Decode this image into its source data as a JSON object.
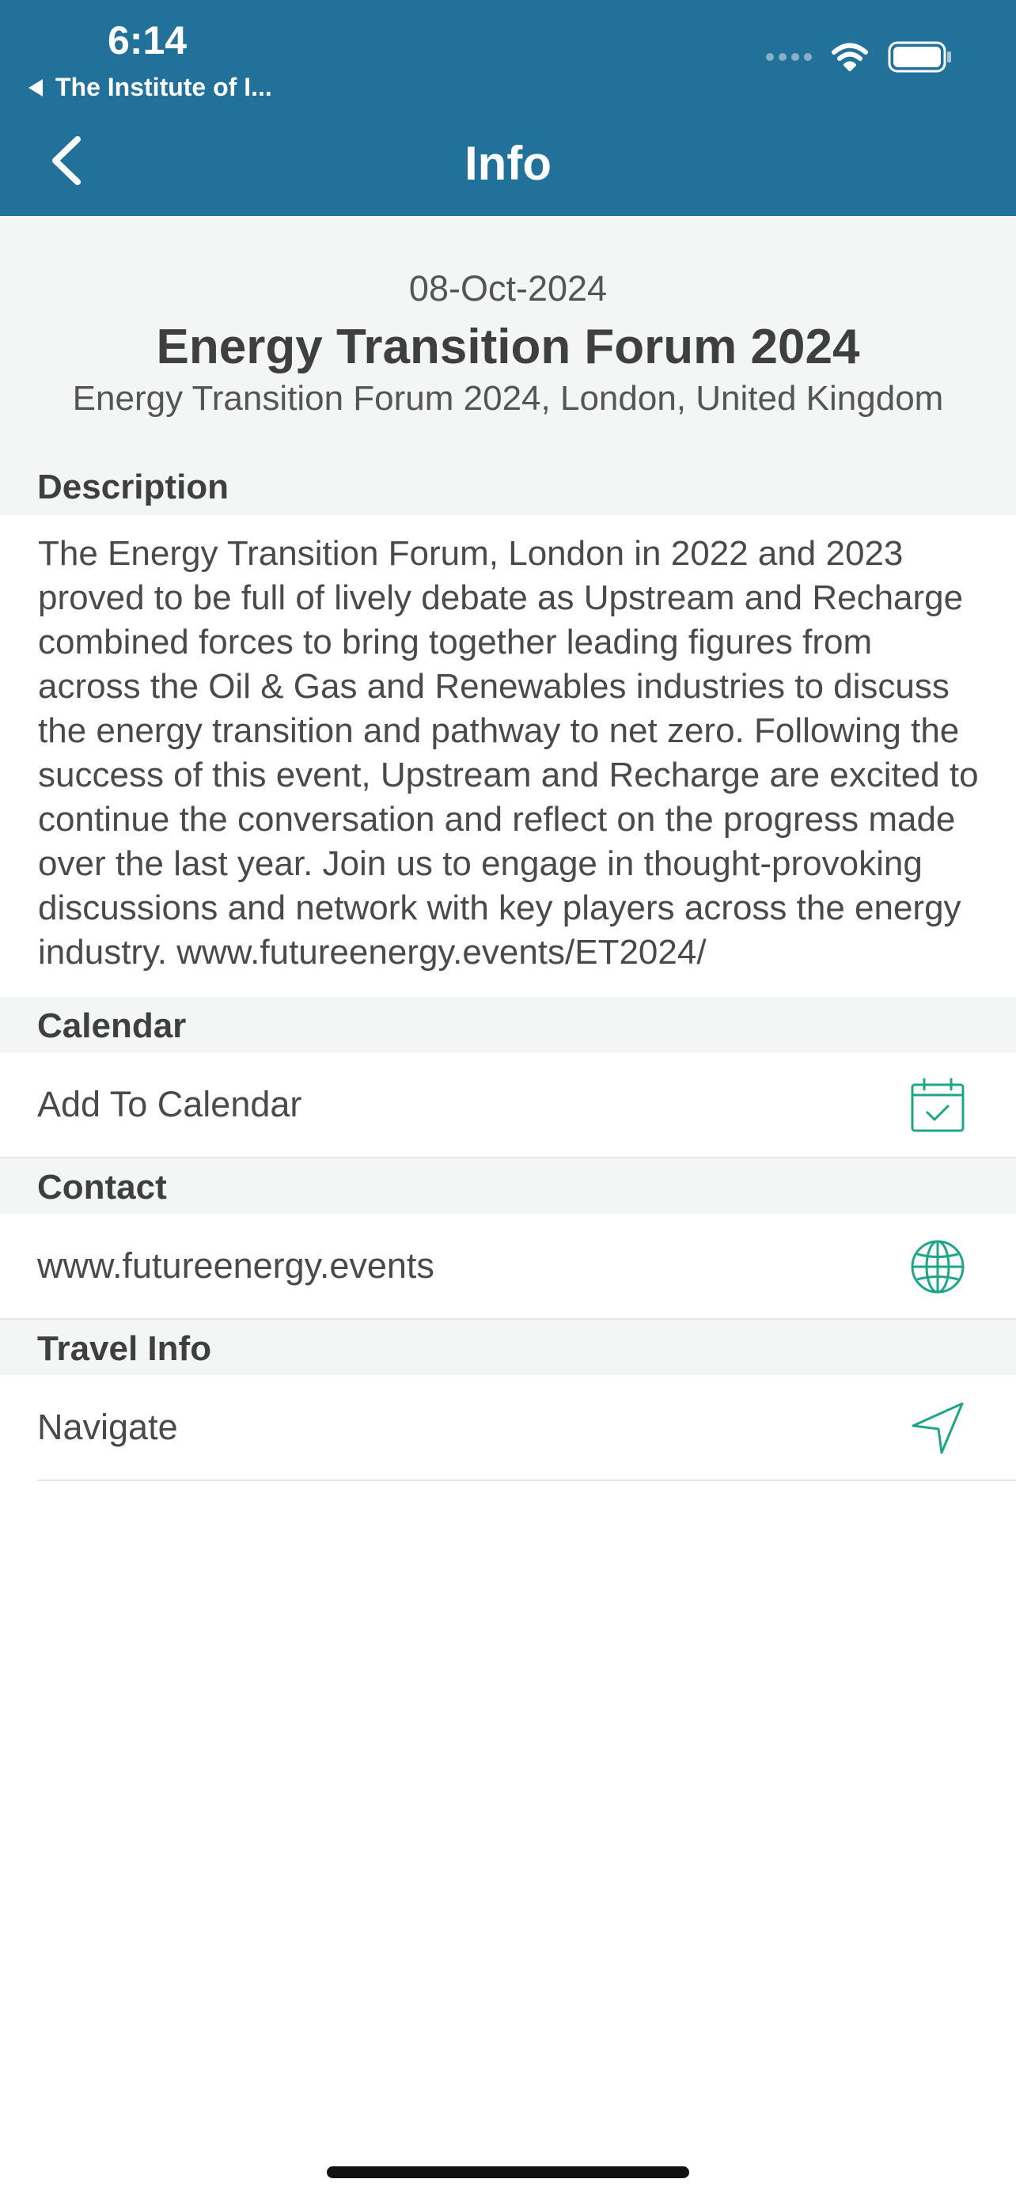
{
  "status_bar": {
    "time": "6:14",
    "back_app": "The Institute of I..."
  },
  "nav": {
    "title": "Info"
  },
  "event": {
    "date": "08-Oct-2024",
    "title": "Energy Transition Forum 2024",
    "location": "Energy Transition Forum 2024, London, United Kingdom"
  },
  "sections": {
    "description_label": "Description",
    "description_text": "The Energy Transition Forum, London in 2022 and 2023\nproved to be full of lively debate as Upstream and Recharge\ncombined forces to bring together leading figures from\nacross the Oil & Gas and Renewables industries to discuss\nthe energy transition and pathway to net zero. Following the\nsuccess of this event, Upstream and Recharge are excited to\ncontinue the conversation and reflect on the progress made\nover the last year. Join us to engage in thought-provoking\ndiscussions and network with key players across the energy\nindustry. www.futureenergy.events/ET2024/",
    "calendar_label": "Calendar",
    "calendar_action": "Add To Calendar",
    "contact_label": "Contact",
    "contact_website": "www.futureenergy.events",
    "travel_label": "Travel Info",
    "travel_action": "Navigate"
  },
  "colors": {
    "header": "#22719a",
    "section_band": "#f4f5f5",
    "icon_accent": "#1fa58a"
  },
  "icons": {
    "calendar": "calendar-check-icon",
    "contact": "globe-icon",
    "travel": "navigation-arrow-icon"
  }
}
